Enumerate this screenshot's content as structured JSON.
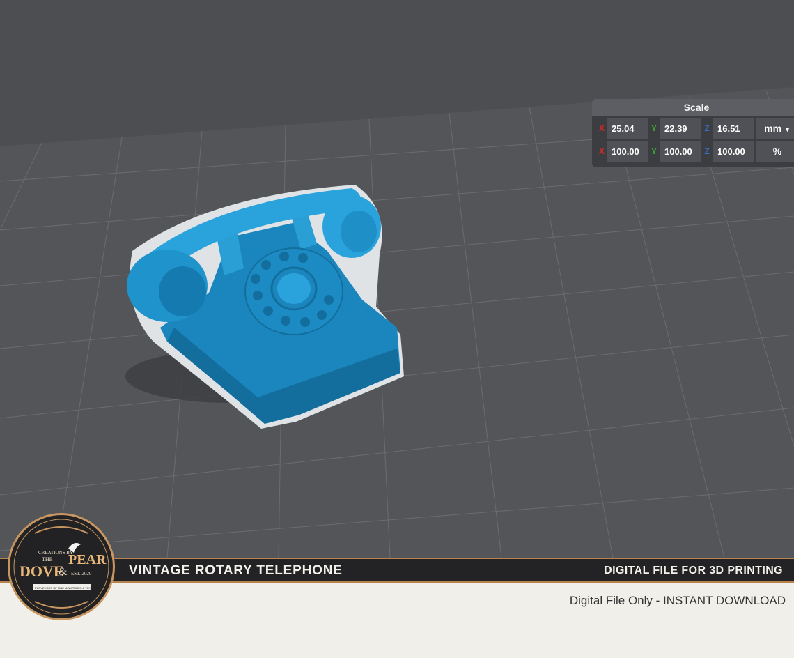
{
  "scale_panel": {
    "title": "Scale",
    "size_row": {
      "x_label": "X",
      "x": "25.04",
      "y_label": "Y",
      "y": "22.39",
      "z_label": "Z",
      "z": "16.51",
      "unit": "mm"
    },
    "percent_row": {
      "x_label": "X",
      "x": "100.00",
      "y_label": "Y",
      "y": "100.00",
      "z_label": "Z",
      "z": "100.00",
      "unit": "%"
    }
  },
  "banner": {
    "title": "VINTAGE ROTARY TELEPHONE",
    "right_text": "DIGITAL FILE FOR 3D PRINTING"
  },
  "subline": "Digital File Only - INSTANT DOWNLOAD",
  "logo": {
    "top": "CREATIONS BY",
    "the": "THE",
    "name_left": "DOVE",
    "amp": "&",
    "name_right": "PEAR",
    "est": "EST. 2020",
    "tagline": "PURVEYORS OF FINE MINIATURES & TOYS"
  },
  "colors": {
    "viewport_bg": "#4d4e52",
    "model_blue": "#1e8fc6",
    "banner_bg": "#232325",
    "banner_border": "#b8834e",
    "page_bg": "#f1efe9"
  }
}
